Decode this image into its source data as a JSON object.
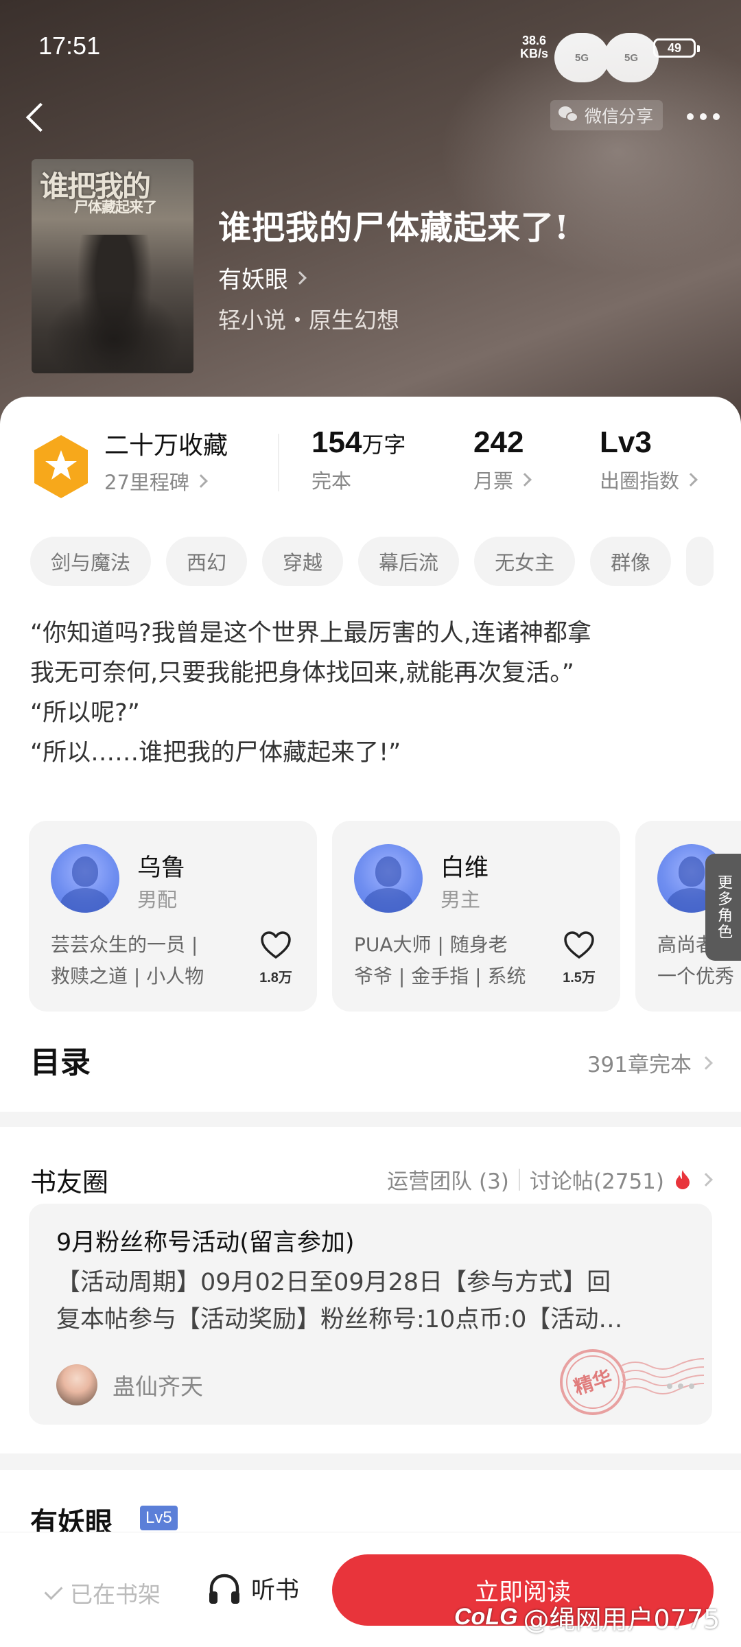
{
  "status_bar": {
    "time": "17:51",
    "net_speed_value": "38.6",
    "net_speed_unit": "KB/s",
    "signal1_label": "5G",
    "signal2_label": "5G",
    "battery": "49"
  },
  "header": {
    "share_label": "微信分享",
    "cover_title": "谁把我的",
    "cover_subtitle": "尸体藏起来了",
    "book_title": "谁把我的尸体藏起来了!",
    "author": "有妖眼",
    "genre": "轻小说・原生幻想"
  },
  "stats": {
    "collections": "二十万收藏",
    "milestone": "27里程碑",
    "word_count": "154",
    "word_unit": "万字",
    "status": "完本",
    "monthly_votes": "242",
    "monthly_votes_label": "月票",
    "level": "Lv3",
    "level_label": "出圈指数"
  },
  "tags": [
    "剑与魔法",
    "西幻",
    "穿越",
    "幕后流",
    "无女主",
    "群像"
  ],
  "synopsis": [
    "“你知道吗?我曾是这个世界上最厉害的人,连诸神都拿",
    "我无可奈何,只要我能把身体找回来,就能再次复活。”",
    "“所以呢?”",
    "“所以……谁把我的尸体藏起来了!”"
  ],
  "characters": [
    {
      "name": "乌鲁",
      "role": "男配",
      "desc1": "芸芸众生的一员 |",
      "desc2": "救赎之道 | 小人物",
      "likes": "1.8万"
    },
    {
      "name": "白维",
      "role": "男主",
      "desc1": "PUA大师 | 随身老",
      "desc2": "爷爷 | 金手指 | 系统",
      "likes": "1.5万"
    },
    {
      "name": "",
      "role": "",
      "desc1": "高尚者的",
      "desc2": "一个优秀",
      "likes": ""
    }
  ],
  "more_roles_label": "更多角色",
  "toc": {
    "title": "目录",
    "meta": "391章完本"
  },
  "circle": {
    "title": "书友圈",
    "team": "运营团队 (3)",
    "posts_count": "讨论帖(2751)",
    "post_title": "9月粉丝称号活动(留言参加)",
    "post_line1": "【活动周期】09月02日至09月28日【参与方式】回",
    "post_line2": "复本帖参与【活动奖励】粉丝称号:10点币:0【活动…",
    "post_user": "蛊仙齐天",
    "stamp_label": "精华"
  },
  "author_section": {
    "name": "有妖眼",
    "level": "Lv5"
  },
  "bottom": {
    "shelf_label": "已在书架",
    "listen_label": "听书",
    "read_label": "立即阅读"
  },
  "watermark": {
    "logo": "CoLG",
    "text": "@绳网用户0775"
  },
  "colors": {
    "accent_red": "#e8343b",
    "badge_orange": "#f7a81b",
    "level_blue": "#5b7fd8"
  }
}
